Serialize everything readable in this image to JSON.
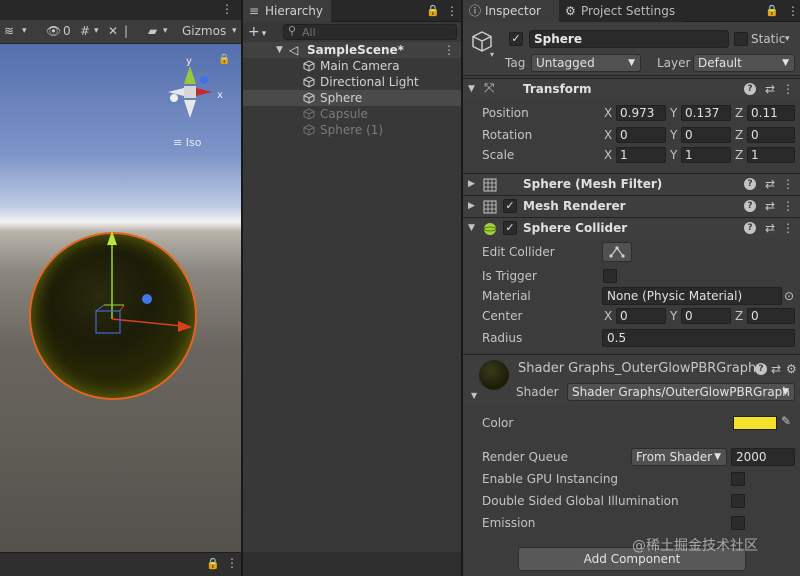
{
  "scene": {
    "toolbar": {
      "visibility_count": "0",
      "gizmos_label": "Gizmos"
    },
    "iso_label": "Iso",
    "axis_labels": {
      "y": "y",
      "x": "x"
    }
  },
  "hierarchy": {
    "tab_label": "Hierarchy",
    "search_placeholder": "All",
    "scene_name": "SampleScene*",
    "items": [
      {
        "label": "Main Camera",
        "active": true,
        "selected": false
      },
      {
        "label": "Directional Light",
        "active": true,
        "selected": false
      },
      {
        "label": "Sphere",
        "active": true,
        "selected": true
      },
      {
        "label": "Capsule",
        "active": false,
        "selected": false
      },
      {
        "label": "Sphere (1)",
        "active": false,
        "selected": false
      }
    ]
  },
  "inspector": {
    "tabs": [
      {
        "label": "Inspector",
        "icon": "info-icon",
        "active": true
      },
      {
        "label": "Project Settings",
        "icon": "gear-icon",
        "active": false
      }
    ],
    "object_name": "Sphere",
    "static_label": "Static",
    "tag_label": "Tag",
    "tag_value": "Untagged",
    "layer_label": "Layer",
    "layer_value": "Default",
    "transform": {
      "title": "Transform",
      "position_label": "Position",
      "rotation_label": "Rotation",
      "scale_label": "Scale",
      "position": {
        "x": "0.973",
        "y": "0.137",
        "z": "0.11"
      },
      "rotation": {
        "x": "0",
        "y": "0",
        "z": "0"
      },
      "scale": {
        "x": "1",
        "y": "1",
        "z": "1"
      }
    },
    "components": [
      {
        "title": "Sphere (Mesh Filter)",
        "icon": "grid-icon"
      },
      {
        "title": "Mesh Renderer",
        "icon": "grid-icon"
      },
      {
        "title": "Sphere Collider",
        "icon": "sphere-collider-icon"
      }
    ],
    "collider": {
      "edit_label": "Edit Collider",
      "is_trigger_label": "Is Trigger",
      "material_label": "Material",
      "material_value": "None (Physic Material)",
      "center_label": "Center",
      "center": {
        "x": "0",
        "y": "0",
        "z": "0"
      },
      "radius_label": "Radius",
      "radius": "0.5"
    },
    "material": {
      "title": "Shader Graphs_OuterGlowPBRGraph",
      "shader_label": "Shader",
      "shader_value": "Shader Graphs/OuterGlowPBRGraph",
      "color_label": "Color",
      "color_value": "#f5e02a",
      "render_queue_label": "Render Queue",
      "render_queue_mode": "From Shader",
      "render_queue_value": "2000",
      "gpu_instancing_label": "Enable GPU Instancing",
      "double_sided_gi_label": "Double Sided Global Illumination",
      "emission_label": "Emission"
    },
    "add_component_label": "Add Component",
    "axis": {
      "x": "X",
      "y": "Y",
      "z": "Z"
    }
  },
  "watermark": "@稀土掘金技术社区"
}
